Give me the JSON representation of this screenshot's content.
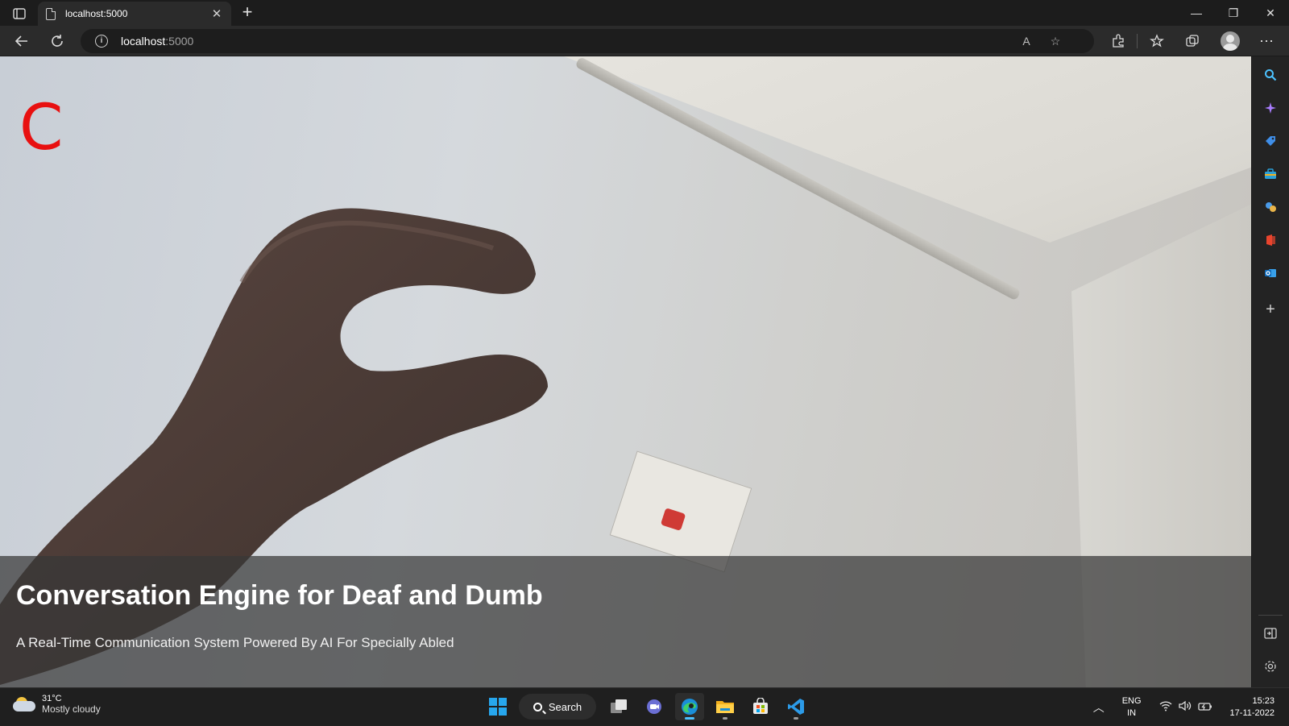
{
  "browser": {
    "tab_title": "localhost:5000",
    "url_host": "localhost",
    "url_port": ":5000"
  },
  "page": {
    "detected_sign": "C",
    "title": "Conversation Engine for Deaf and Dumb",
    "subtitle": "A Real-Time Communication System Powered By AI For Specially Abled"
  },
  "taskbar": {
    "weather_temp": "31°C",
    "weather_condition": "Mostly cloudy",
    "search_label": "Search",
    "language_line1": "ENG",
    "language_line2": "IN",
    "time": "15:23",
    "date": "17-11-2022"
  },
  "colors": {
    "sign_letter": "#e81010",
    "accent": "#4cc2ff"
  }
}
